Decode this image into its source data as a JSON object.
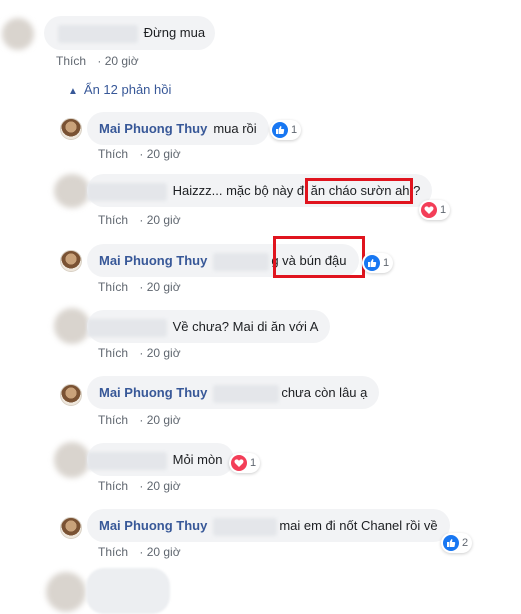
{
  "top_comment": {
    "text": "Đừng mua",
    "like_label": "Thích",
    "time": "20 giờ"
  },
  "view_replies": {
    "label": "Ẩn 12 phản hồi",
    "icon": "chevron-up-icon"
  },
  "replies": [
    {
      "author": "Mai Phuong Thuy",
      "text": "mua rồi",
      "like_label": "Thích",
      "time": "20 giờ",
      "reaction": "like",
      "count": "1"
    },
    {
      "author": "",
      "text": "Haizzz... mặc bộ này đi ăn cháo sườn ah ?",
      "like_label": "Thích",
      "time": "20 giờ",
      "reaction": "love",
      "count": "1"
    },
    {
      "author": "Mai Phuong Thuy",
      "text": "g và bún đậu",
      "like_label": "Thích",
      "time": "20 giờ",
      "reaction": "like",
      "count": "1"
    },
    {
      "author": "",
      "text": "Về chưa? Mai di ăn với A",
      "like_label": "Thích",
      "time": "20 giờ",
      "reaction": "",
      "count": ""
    },
    {
      "author": "Mai Phuong Thuy",
      "text": "chưa còn lâu ạ",
      "like_label": "Thích",
      "time": "20 giờ",
      "reaction": "",
      "count": ""
    },
    {
      "author": "",
      "text": "Mỏi mòn",
      "like_label": "Thích",
      "time": "20 giờ",
      "reaction": "love",
      "count": "1"
    },
    {
      "author": "Mai Phuong Thuy",
      "text": "mai em đi nốt Chanel rồi về",
      "like_label": "Thích",
      "time": "20 giờ",
      "reaction": "like",
      "count": "2"
    }
  ],
  "colors": {
    "author_link": "#385898",
    "bubble_bg": "#f2f3f5",
    "meta_text": "#606770",
    "like_blue": "#1877f2",
    "love_red": "#f33e58",
    "highlight_box": "#e0141e"
  }
}
